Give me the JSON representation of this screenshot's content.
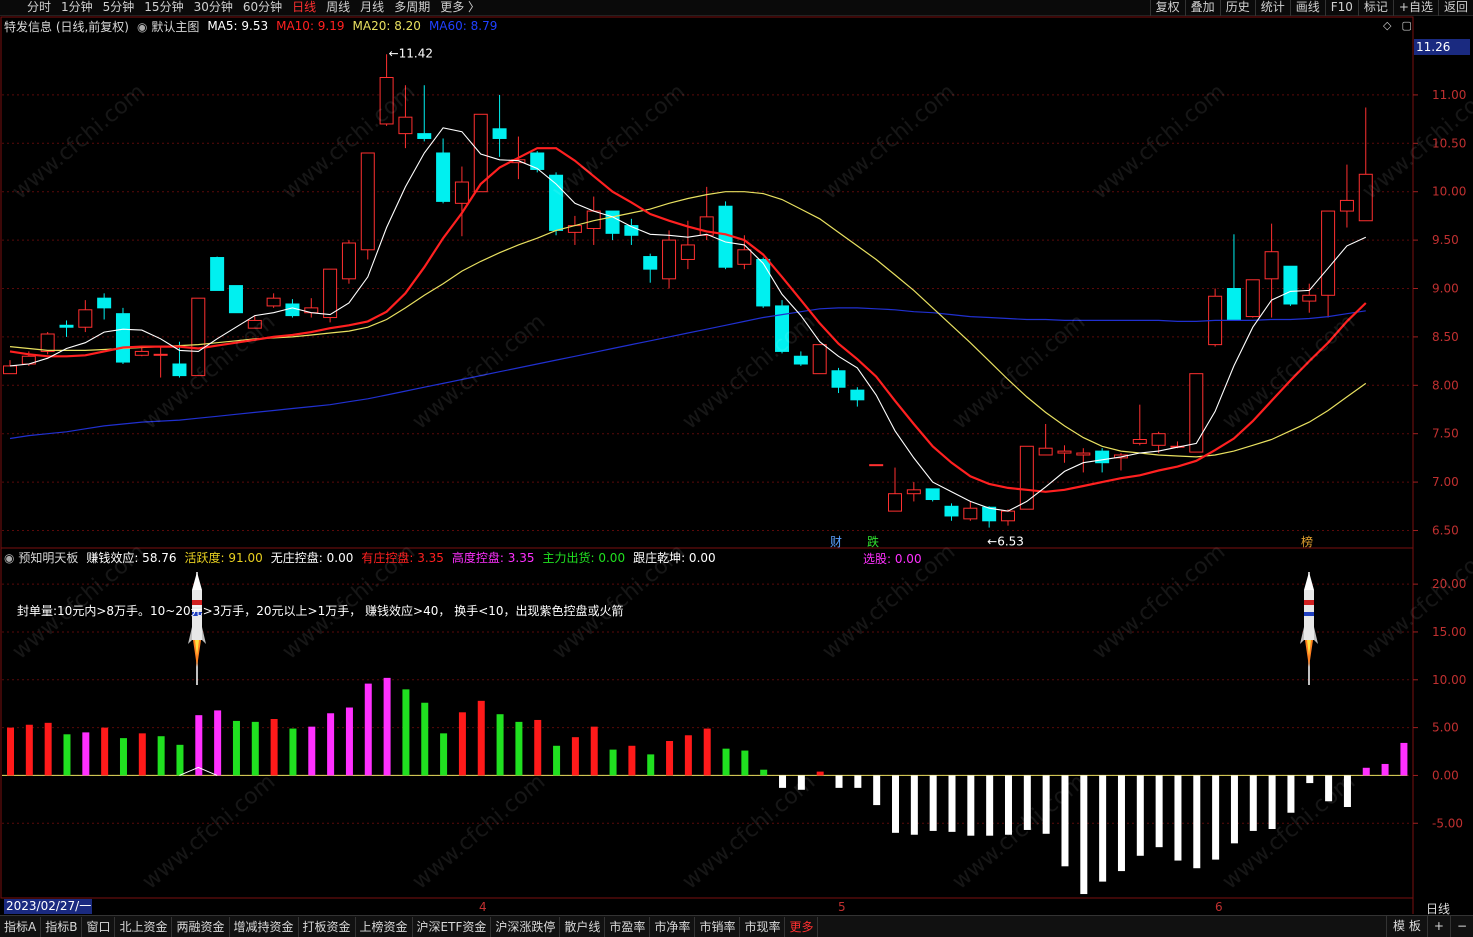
{
  "topbar": {
    "periods": [
      "分时",
      "1分钟",
      "5分钟",
      "15分钟",
      "30分钟",
      "60分钟",
      "日线",
      "周线",
      "月线",
      "多周期",
      "更多 〉"
    ],
    "active_index": 6,
    "tools": [
      "复权",
      "叠加",
      "历史",
      "统计",
      "画线",
      "F10",
      "标记",
      "+自选",
      "返回"
    ]
  },
  "main_legend": {
    "stock": "特发信息 (日线,前复权)",
    "indicator": "默认主图",
    "ma5": "MA5: 9.53",
    "ma10": "MA10: 9.19",
    "ma20": "MA20: 8.20",
    "ma60": "MA60: 8.79"
  },
  "main_axis": {
    "current_price": "11.26",
    "ticks": [
      "11.00",
      "10.50",
      "10.00",
      "9.50",
      "9.00",
      "8.50",
      "8.00",
      "7.50",
      "7.00",
      "6.50"
    ],
    "high_label": "11.42",
    "low_label": "6.53",
    "events": [
      "财",
      "跌",
      "榜"
    ]
  },
  "sub_legend": {
    "name": "预知明天板",
    "items": [
      {
        "label": "赚钱效应: 58.76",
        "color": "#ffffff"
      },
      {
        "label": "活跃度: 91.00",
        "color": "#e8d020"
      },
      {
        "label": "无庄控盘: 0.00",
        "color": "#ffffff"
      },
      {
        "label": "有庄控盘: 3.35",
        "color": "#ff2020"
      },
      {
        "label": "高度控盘: 3.35",
        "color": "#ff30ff"
      },
      {
        "label": "主力出货: 0.00",
        "color": "#20e020"
      },
      {
        "label": "跟庄乾坤: 0.00",
        "color": "#ffffff"
      }
    ],
    "xuangu": "选股: 0.00",
    "note": "封单量:10元内>8万手。10~20元>3万手，20元以上>1万手， 赚钱效应>40， 换手<10，出现紫色控盘或火箭"
  },
  "sub_axis": {
    "ticks": [
      "20.00",
      "15.00",
      "10.00",
      "5.00",
      "0.00",
      "-5.00"
    ]
  },
  "x_axis": {
    "start_date": "2023/02/27/一",
    "months": [
      "4",
      "5",
      "6"
    ],
    "period": "日线"
  },
  "bottombar": {
    "tabs": [
      "指标A",
      "指标B",
      "窗口",
      "北上资金",
      "两融资金",
      "增减持资金",
      "打板资金",
      "上榜资金",
      "沪深ETF资金",
      "沪深涨跌停",
      "散户线",
      "市盈率",
      "市净率",
      "市销率",
      "市现率",
      "更多"
    ],
    "active_index": 15,
    "right": [
      "模 板",
      "+",
      "−"
    ]
  },
  "colors": {
    "up": "#ff3030",
    "down": "#00f0f0",
    "ma5": "#ffffff",
    "ma10": "#ff2020",
    "ma20": "#e8e060",
    "ma60": "#2030d0"
  },
  "chart_data": {
    "type": "candlestick",
    "candles": [
      [
        8.12,
        8.2,
        8.26,
        8.12
      ],
      [
        8.22,
        8.3,
        8.35,
        8.2
      ],
      [
        8.35,
        8.53,
        8.55,
        8.32
      ],
      [
        8.62,
        8.6,
        8.67,
        8.5
      ],
      [
        8.6,
        8.78,
        8.88,
        8.55
      ],
      [
        8.9,
        8.8,
        8.95,
        8.68
      ],
      [
        8.74,
        8.24,
        8.8,
        8.22
      ],
      [
        8.31,
        8.35,
        8.41,
        8.3
      ],
      [
        8.32,
        8.32,
        8.4,
        8.08
      ],
      [
        8.22,
        8.1,
        8.45,
        8.08
      ],
      [
        8.1,
        8.9,
        8.9,
        8.1
      ],
      [
        9.32,
        8.98,
        9.33,
        8.98
      ],
      [
        9.03,
        8.75,
        9.03,
        8.75
      ],
      [
        8.59,
        8.67,
        8.72,
        8.59
      ],
      [
        8.82,
        8.9,
        8.95,
        8.8
      ],
      [
        8.84,
        8.72,
        8.89,
        8.7
      ],
      [
        8.75,
        8.8,
        8.9,
        8.7
      ],
      [
        8.7,
        9.2,
        9.2,
        8.65
      ],
      [
        9.1,
        9.47,
        9.5,
        9.05
      ],
      [
        9.4,
        10.4,
        10.4,
        9.3
      ],
      [
        10.7,
        11.18,
        11.42,
        10.68
      ],
      [
        10.6,
        10.77,
        11.1,
        10.45
      ],
      [
        10.6,
        10.55,
        11.1,
        10.52
      ],
      [
        10.4,
        9.9,
        10.55,
        9.88
      ],
      [
        9.88,
        10.1,
        10.26,
        9.54
      ],
      [
        10.0,
        10.8,
        10.8,
        10.0
      ],
      [
        10.65,
        10.55,
        11.0,
        10.36
      ],
      [
        10.3,
        10.33,
        10.57,
        10.13
      ],
      [
        10.4,
        10.23,
        10.42,
        10.2
      ],
      [
        10.17,
        9.6,
        10.2,
        9.55
      ],
      [
        9.58,
        9.65,
        9.75,
        9.45
      ],
      [
        9.62,
        9.8,
        9.95,
        9.45
      ],
      [
        9.8,
        9.57,
        9.8,
        9.5
      ],
      [
        9.65,
        9.55,
        9.72,
        9.45
      ],
      [
        9.33,
        9.2,
        9.36,
        9.06
      ],
      [
        9.1,
        9.5,
        9.6,
        9.0
      ],
      [
        9.3,
        9.45,
        9.7,
        9.2
      ],
      [
        9.55,
        9.74,
        10.05,
        9.5
      ],
      [
        9.85,
        9.22,
        9.9,
        9.2
      ],
      [
        9.25,
        9.4,
        9.55,
        9.2
      ],
      [
        9.3,
        8.82,
        9.32,
        8.8
      ],
      [
        8.82,
        8.35,
        8.88,
        8.33
      ],
      [
        8.3,
        8.22,
        8.35,
        8.2
      ],
      [
        8.12,
        8.42,
        8.42,
        8.12
      ],
      [
        8.15,
        7.98,
        8.18,
        7.92
      ],
      [
        7.95,
        7.85,
        7.98,
        7.78
      ],
      [
        7.17,
        7.18,
        7.18,
        7.17
      ],
      [
        6.7,
        6.88,
        7.15,
        6.7
      ],
      [
        6.88,
        6.92,
        7.0,
        6.8
      ],
      [
        6.93,
        6.82,
        6.93,
        6.8
      ],
      [
        6.75,
        6.65,
        6.78,
        6.6
      ],
      [
        6.62,
        6.73,
        6.8,
        6.6
      ],
      [
        6.74,
        6.6,
        6.75,
        6.53
      ],
      [
        6.6,
        6.7,
        6.72,
        6.55
      ],
      [
        6.72,
        7.37,
        7.37,
        6.72
      ],
      [
        7.28,
        7.35,
        7.6,
        7.28
      ],
      [
        7.3,
        7.32,
        7.38,
        7.2
      ],
      [
        7.28,
        7.3,
        7.35,
        7.1
      ],
      [
        7.32,
        7.2,
        7.35,
        7.1
      ],
      [
        7.25,
        7.28,
        7.3,
        7.12
      ],
      [
        7.4,
        7.44,
        7.8,
        7.38
      ],
      [
        7.38,
        7.5,
        7.52,
        7.3
      ],
      [
        7.37,
        7.37,
        7.42,
        7.35
      ],
      [
        7.31,
        8.12,
        8.12,
        7.31
      ],
      [
        8.42,
        8.92,
        9.0,
        8.4
      ],
      [
        9.0,
        8.68,
        9.56,
        8.68
      ],
      [
        8.71,
        9.09,
        9.09,
        8.7
      ],
      [
        9.1,
        9.38,
        9.67,
        8.7
      ],
      [
        9.23,
        8.84,
        9.23,
        8.82
      ],
      [
        8.87,
        8.93,
        9.05,
        8.75
      ],
      [
        8.93,
        9.8,
        9.8,
        8.7
      ],
      [
        9.8,
        9.91,
        10.28,
        9.63
      ],
      [
        9.7,
        10.18,
        10.87,
        9.7
      ]
    ],
    "ma5": [
      8.2,
      8.22,
      8.28,
      8.38,
      8.44,
      8.55,
      8.58,
      8.57,
      8.48,
      8.36,
      8.35,
      8.48,
      8.6,
      8.72,
      8.75,
      8.8,
      8.75,
      8.73,
      8.85,
      9.12,
      9.63,
      10.05,
      10.4,
      10.66,
      10.62,
      10.39,
      10.33,
      10.32,
      10.24,
      10.08,
      9.88,
      9.8,
      9.74,
      9.64,
      9.56,
      9.55,
      9.53,
      9.56,
      9.48,
      9.45,
      9.26,
      8.94,
      8.72,
      8.45,
      8.3,
      8.18,
      7.9,
      7.53,
      7.25,
      7.0,
      6.9,
      6.8,
      6.73,
      6.7,
      6.8,
      6.95,
      7.11,
      7.2,
      7.23,
      7.26,
      7.3,
      7.32,
      7.36,
      7.4,
      7.73,
      8.2,
      8.6,
      8.88,
      8.97,
      8.98,
      9.21,
      9.44,
      9.53
    ],
    "ma10": [
      8.35,
      8.32,
      8.3,
      8.3,
      8.31,
      8.35,
      8.39,
      8.4,
      8.4,
      8.4,
      8.38,
      8.41,
      8.44,
      8.47,
      8.5,
      8.52,
      8.55,
      8.59,
      8.62,
      8.66,
      8.76,
      8.95,
      9.22,
      9.52,
      9.78,
      10.08,
      10.25,
      10.35,
      10.45,
      10.45,
      10.32,
      10.16,
      10.0,
      9.89,
      9.77,
      9.7,
      9.64,
      9.59,
      9.56,
      9.5,
      9.35,
      9.12,
      8.88,
      8.64,
      8.43,
      8.27,
      8.09,
      7.84,
      7.6,
      7.37,
      7.2,
      7.06,
      6.98,
      6.94,
      6.92,
      6.9,
      6.92,
      6.96,
      7.0,
      7.04,
      7.07,
      7.12,
      7.16,
      7.22,
      7.33,
      7.45,
      7.63,
      7.84,
      8.05,
      8.25,
      8.44,
      8.66,
      8.85
    ],
    "ma20": [
      8.4,
      8.38,
      8.36,
      8.36,
      8.36,
      8.37,
      8.38,
      8.39,
      8.4,
      8.41,
      8.42,
      8.44,
      8.46,
      8.48,
      8.49,
      8.5,
      8.52,
      8.54,
      8.56,
      8.6,
      8.68,
      8.8,
      8.93,
      9.05,
      9.18,
      9.28,
      9.37,
      9.45,
      9.52,
      9.6,
      9.65,
      9.7,
      9.74,
      9.78,
      9.82,
      9.88,
      9.93,
      9.97,
      10.0,
      10.0,
      9.98,
      9.92,
      9.82,
      9.72,
      9.58,
      9.44,
      9.3,
      9.14,
      8.98,
      8.8,
      8.62,
      8.44,
      8.25,
      8.06,
      7.88,
      7.72,
      7.58,
      7.46,
      7.37,
      7.32,
      7.3,
      7.28,
      7.27,
      7.26,
      7.28,
      7.32,
      7.38,
      7.44,
      7.53,
      7.62,
      7.74,
      7.88,
      8.02
    ],
    "ma60": [
      7.45,
      7.48,
      7.5,
      7.52,
      7.55,
      7.58,
      7.6,
      7.62,
      7.63,
      7.64,
      7.66,
      7.68,
      7.7,
      7.72,
      7.74,
      7.76,
      7.78,
      7.8,
      7.83,
      7.86,
      7.9,
      7.94,
      7.98,
      8.02,
      8.06,
      8.1,
      8.14,
      8.18,
      8.22,
      8.26,
      8.3,
      8.34,
      8.38,
      8.42,
      8.46,
      8.5,
      8.54,
      8.58,
      8.62,
      8.66,
      8.7,
      8.73,
      8.76,
      8.79,
      8.8,
      8.8,
      8.79,
      8.78,
      8.76,
      8.75,
      8.73,
      8.71,
      8.7,
      8.69,
      8.68,
      8.68,
      8.67,
      8.67,
      8.67,
      8.67,
      8.67,
      8.67,
      8.66,
      8.66,
      8.67,
      8.67,
      8.67,
      8.68,
      8.68,
      8.69,
      8.71,
      8.74,
      8.77
    ],
    "indicator_bars": [
      [
        5.0,
        "r"
      ],
      [
        5.3,
        "r"
      ],
      [
        5.5,
        "r"
      ],
      [
        4.3,
        "g"
      ],
      [
        4.5,
        "m"
      ],
      [
        5.0,
        "r"
      ],
      [
        3.9,
        "g"
      ],
      [
        4.4,
        "r"
      ],
      [
        4.1,
        "g"
      ],
      [
        3.2,
        "g"
      ],
      [
        6.3,
        "m"
      ],
      [
        6.8,
        "m"
      ],
      [
        5.7,
        "g"
      ],
      [
        5.6,
        "g"
      ],
      [
        5.9,
        "r"
      ],
      [
        4.9,
        "g"
      ],
      [
        5.1,
        "m"
      ],
      [
        6.5,
        "m"
      ],
      [
        7.1,
        "m"
      ],
      [
        9.6,
        "m"
      ],
      [
        10.2,
        "m"
      ],
      [
        9.0,
        "g"
      ],
      [
        7.6,
        "g"
      ],
      [
        4.4,
        "g"
      ],
      [
        6.6,
        "r"
      ],
      [
        7.8,
        "r"
      ],
      [
        6.4,
        "g"
      ],
      [
        5.6,
        "g"
      ],
      [
        5.8,
        "r"
      ],
      [
        3.1,
        "g"
      ],
      [
        4.0,
        "r"
      ],
      [
        5.1,
        "r"
      ],
      [
        2.7,
        "g"
      ],
      [
        3.1,
        "r"
      ],
      [
        2.2,
        "g"
      ],
      [
        3.6,
        "r"
      ],
      [
        4.2,
        "r"
      ],
      [
        4.9,
        "r"
      ],
      [
        2.8,
        "g"
      ],
      [
        2.6,
        "g"
      ],
      [
        0.6,
        "g"
      ],
      [
        -1.3,
        "w"
      ],
      [
        -1.5,
        "w"
      ],
      [
        0.4,
        "r"
      ],
      [
        -1.3,
        "w"
      ],
      [
        -1.3,
        "w"
      ],
      [
        -3.1,
        "w"
      ],
      [
        -6.0,
        "w"
      ],
      [
        -6.2,
        "w"
      ],
      [
        -5.8,
        "w"
      ],
      [
        -5.9,
        "w"
      ],
      [
        -6.3,
        "w"
      ],
      [
        -6.3,
        "w"
      ],
      [
        -6.2,
        "w"
      ],
      [
        -5.7,
        "w"
      ],
      [
        -6.1,
        "w"
      ],
      [
        -9.5,
        "w"
      ],
      [
        -12.4,
        "w"
      ],
      [
        -11.1,
        "w"
      ],
      [
        -10.0,
        "w"
      ],
      [
        -8.4,
        "w"
      ],
      [
        -7.5,
        "w"
      ],
      [
        -8.9,
        "w"
      ],
      [
        -9.7,
        "w"
      ],
      [
        -8.8,
        "w"
      ],
      [
        -7.1,
        "w"
      ],
      [
        -5.8,
        "w"
      ],
      [
        -5.6,
        "w"
      ],
      [
        -3.9,
        "w"
      ],
      [
        -0.8,
        "w"
      ],
      [
        -2.7,
        "w"
      ],
      [
        -3.3,
        "w"
      ],
      [
        0.8,
        "m"
      ],
      [
        1.2,
        "m"
      ],
      [
        3.4,
        "m"
      ]
    ],
    "y_range_main": [
      6.35,
      11.65
    ],
    "y_range_sub": [
      -12.5,
      22.0
    ]
  }
}
